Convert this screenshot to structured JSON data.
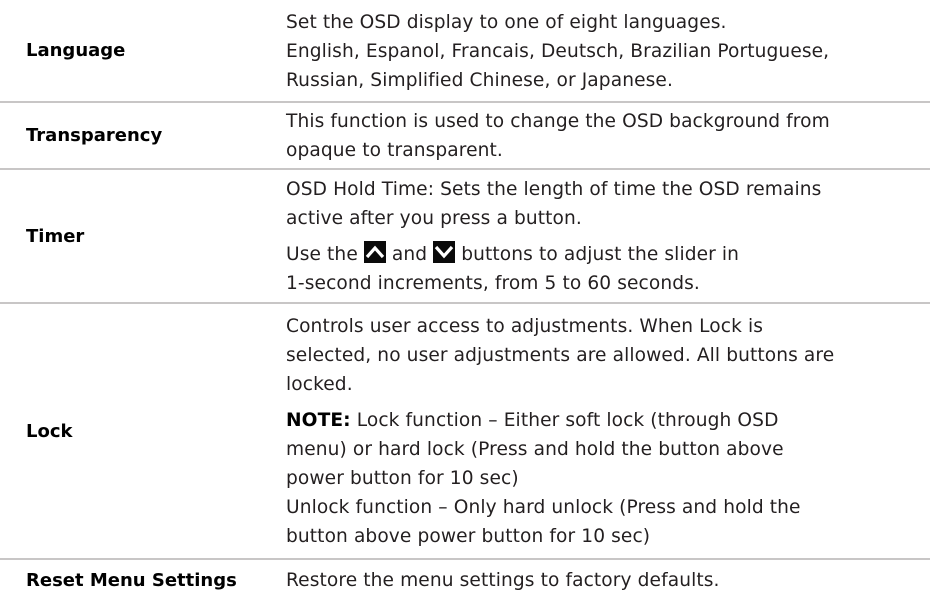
{
  "rows": [
    {
      "label": "Language",
      "lines": [
        "Set the OSD display to one of eight languages.",
        "English, Espanol, Francais, Deutsch, Brazilian Portuguese,",
        "Russian, Simplified Chinese, or Japanese."
      ]
    },
    {
      "label": "Transparency",
      "lines": [
        "This function is used to change the OSD background from",
        "opaque to transparent."
      ]
    },
    {
      "label": "Timer",
      "para1_lines": [
        "OSD Hold Time: Sets the length of time the OSD remains",
        "active after you press a button."
      ],
      "para2_prefix": "Use the",
      "para2_mid": "and",
      "para2_suffix": "buttons to adjust the slider in",
      "para2_line2": "1-second increments, from 5 to 60 seconds.",
      "up_icon": "up-arrow-icon",
      "down_icon": "down-arrow-icon"
    },
    {
      "label": "Lock",
      "para1_lines": [
        "Controls user access to adjustments. When Lock is",
        "selected, no user adjustments are allowed. All buttons are",
        "locked."
      ],
      "note_label": "NOTE:",
      "note_first": "Lock function – Either soft lock (through OSD",
      "note_lines": [
        "menu) or hard lock (Press and hold the button above",
        "power button for 10 sec)",
        "Unlock function – Only hard unlock (Press and hold the",
        "button above power button for 10 sec)"
      ]
    },
    {
      "label": "Reset Menu Settings",
      "lines": [
        "Restore the menu settings to factory defaults."
      ]
    }
  ],
  "colors": {
    "divider": "#c8c6c6",
    "text": "#231f20",
    "icon_bg": "#0a0a0a"
  }
}
